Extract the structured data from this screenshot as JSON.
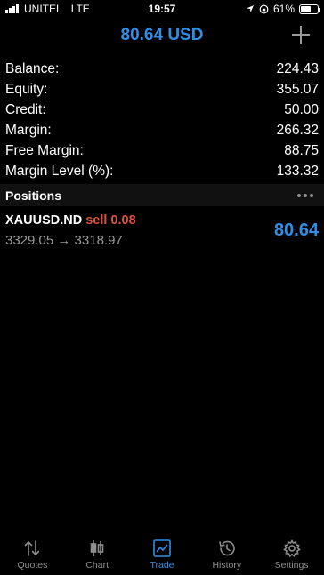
{
  "status_bar": {
    "carrier": "UNITEL",
    "network": "LTE",
    "time": "19:57",
    "battery": "61%",
    "battery_level": 0.61
  },
  "header": {
    "title": "80.64 USD"
  },
  "summary": [
    {
      "label": "Balance:",
      "value": "224.43"
    },
    {
      "label": "Equity:",
      "value": "355.07"
    },
    {
      "label": "Credit:",
      "value": "50.00"
    },
    {
      "label": "Margin:",
      "value": "266.32"
    },
    {
      "label": "Free Margin:",
      "value": "88.75"
    },
    {
      "label": "Margin Level (%):",
      "value": "133.32"
    }
  ],
  "positions": {
    "title": "Positions",
    "items": [
      {
        "symbol": "XAUUSD.ND",
        "side": "sell 0.08",
        "prices": "3329.05 → 3318.97",
        "profit": "80.64"
      }
    ]
  },
  "tabs": [
    {
      "label": "Quotes",
      "icon": "quotes-arrows-icon"
    },
    {
      "label": "Chart",
      "icon": "candlestick-icon"
    },
    {
      "label": "Trade",
      "icon": "trade-chart-icon",
      "active": true
    },
    {
      "label": "History",
      "icon": "history-clock-icon"
    },
    {
      "label": "Settings",
      "icon": "gear-icon"
    }
  ],
  "colors": {
    "accent": "#2f8fe8",
    "sell": "#e0523c",
    "muted": "#9a9a9a"
  }
}
